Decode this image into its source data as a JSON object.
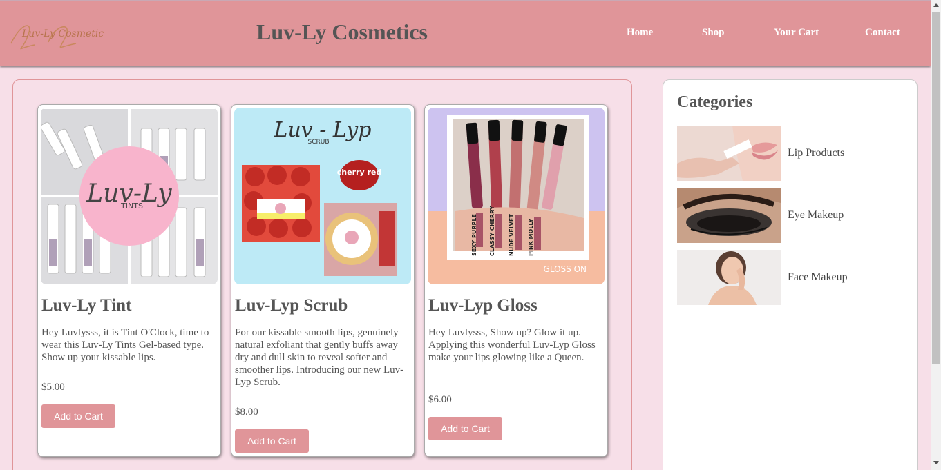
{
  "header": {
    "logo_text": "Luv-Ly Cosmetics",
    "title": "Luv-Ly Cosmetics",
    "nav": [
      "Home",
      "Shop",
      "Your Cart",
      "Contact"
    ]
  },
  "products": [
    {
      "image_text": "Luv-Ly",
      "image_subtext": "TINTS",
      "title": "Luv-Ly Tint",
      "description": "Hey Luvlysss, it is Tint O'Clock, time to wear this Luv-Ly Tints Gel-based type. Show up your kissable lips.",
      "price": "$5.00",
      "button": "Add to Cart"
    },
    {
      "image_text": "Luv - Lyp",
      "image_subtext": "SCRUB",
      "image_badge": "cherry red",
      "title": "Luv-Lyp Scrub",
      "description": "For our kissable smooth lips, genuinely natural exfoliant that gently buffs away dry and dull skin to reveal softer and smoother lips. Introducing our new Luv-Lyp Scrub.",
      "price": "$8.00",
      "button": "Add to Cart"
    },
    {
      "image_swatches": [
        "SEXY PURPLE",
        "CLASSY CHERRY",
        "NUDE VELVET",
        "PINK MOLLY"
      ],
      "image_caption": "GLOSS ON",
      "title": "Luv-Lyp Gloss",
      "description": "Hey Luvlysss, Show up? Glow it up. Applying this wonderful Luv-Lyp Gloss make your lips glowing like a Queen.",
      "price": "$6.00",
      "button": "Add to Cart"
    }
  ],
  "sidebar": {
    "heading": "Categories",
    "categories": [
      {
        "label": "Lip Products"
      },
      {
        "label": "Eye Makeup"
      },
      {
        "label": "Face Makeup"
      }
    ]
  },
  "colors": {
    "header_bg": "#e09599",
    "page_bg": "#f7dfe8",
    "button_bg": "#e09599",
    "text": "#555555"
  }
}
